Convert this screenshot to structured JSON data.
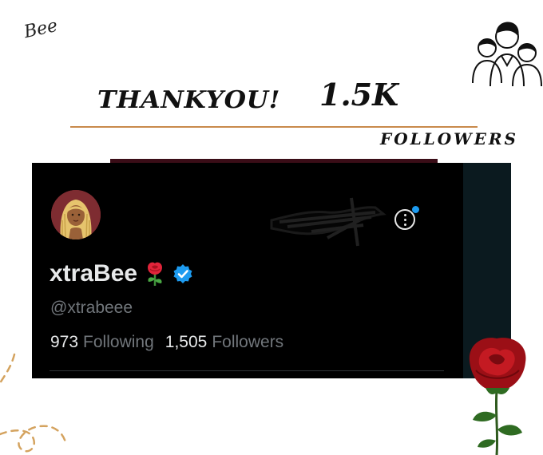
{
  "header": {
    "signature": "Bee",
    "thank_text": "THANKYOU!",
    "count_text": "1.5K",
    "followers_word": "FOLLOWERS"
  },
  "profile": {
    "display_name": "xtraBee",
    "handle": "@xtrabeee",
    "following_count": "973",
    "following_label": "Following",
    "followers_count": "1,505",
    "followers_label": "Followers"
  },
  "icons": {
    "people": "people-group-icon",
    "avatar": "avatar",
    "more": "more-options-icon",
    "verified": "verified-badge-icon",
    "rose": "rose-emoji"
  },
  "colors": {
    "card_bg": "#000000",
    "text_primary": "#e7e9ea",
    "text_secondary": "#71767b",
    "verified_blue": "#1d9bf0",
    "accent_rule": "#c98a4b"
  }
}
